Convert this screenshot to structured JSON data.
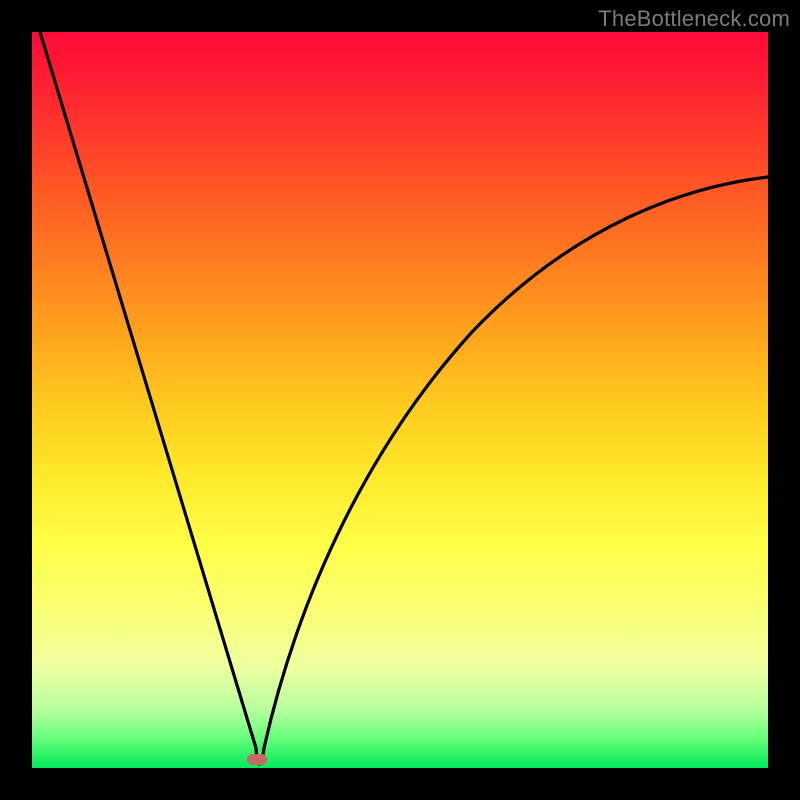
{
  "watermark": "TheBottleneck.com",
  "colors": {
    "frame": "#000000",
    "curve": "#000000",
    "marker": "#c76a64",
    "gradient_top": "#ff0938",
    "gradient_bottom": "#00e85a"
  },
  "chart_data": {
    "type": "line",
    "title": "",
    "xlabel": "",
    "ylabel": "",
    "xlim": [
      0,
      100
    ],
    "ylim": [
      0,
      100
    ],
    "grid": false,
    "series": [
      {
        "name": "bottleneck-curve-left",
        "x": [
          0,
          4,
          8,
          12,
          16,
          20,
          24,
          28,
          30.5
        ],
        "values": [
          100,
          87,
          74,
          60,
          47,
          33,
          20,
          7,
          0
        ]
      },
      {
        "name": "bottleneck-curve-right",
        "x": [
          30.5,
          33,
          36,
          40,
          45,
          50,
          56,
          63,
          71,
          80,
          90,
          100
        ],
        "values": [
          0,
          11,
          22,
          33,
          43,
          51,
          58,
          64,
          69,
          73,
          77,
          80
        ]
      }
    ],
    "annotations": [
      {
        "name": "minimum-marker",
        "x": 30.5,
        "y": 0
      }
    ]
  }
}
